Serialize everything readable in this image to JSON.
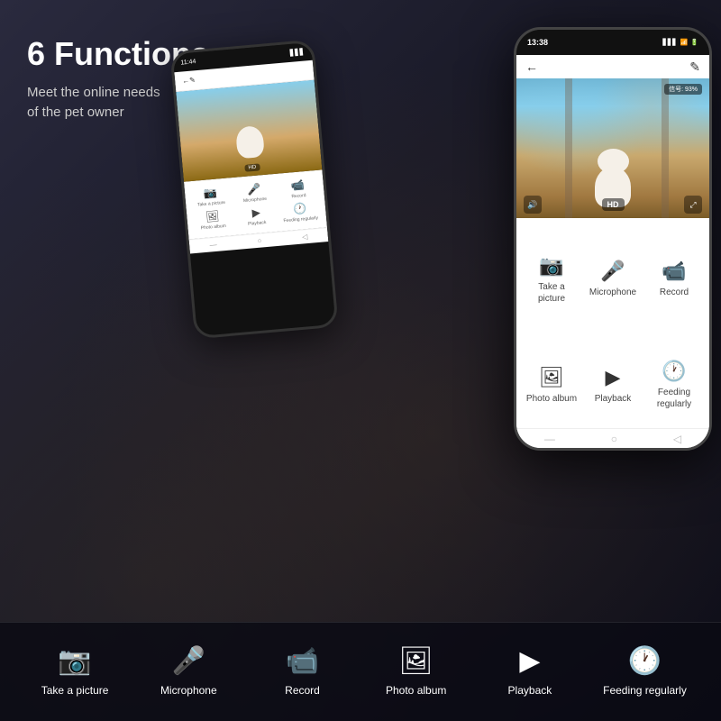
{
  "page": {
    "title": "6 Functions",
    "subtitle_line1": "Meet the online needs",
    "subtitle_line2": "of the pet owner"
  },
  "phone_large": {
    "status_time": "13:38",
    "signal_text": "信号: 93%",
    "back_icon": "←",
    "edit_icon": "✎",
    "hd_label": "HD",
    "video_signal": "信号: 93%",
    "buttons": [
      {
        "icon": "📷",
        "label": "Take a picture"
      },
      {
        "icon": "🎤",
        "label": "Microphone"
      },
      {
        "icon": "📹",
        "label": "Record"
      },
      {
        "icon": "🖼",
        "label": "Photo album"
      },
      {
        "icon": "▶",
        "label": "Playback"
      },
      {
        "icon": "🕐",
        "label": "Feeding regularly"
      }
    ],
    "navbar": [
      "—",
      "○",
      "◁"
    ]
  },
  "phone_small": {
    "buttons_row1": [
      {
        "icon": "📷",
        "label": "Take a picture"
      },
      {
        "icon": "🎤",
        "label": "Microphone"
      },
      {
        "icon": "📹",
        "label": "Record"
      }
    ],
    "buttons_row2": [
      {
        "icon": "🖼",
        "label": "Photo album"
      },
      {
        "icon": "▶",
        "label": "Playback"
      },
      {
        "icon": "🕐",
        "label": "Feeding regularly"
      }
    ]
  },
  "bottom_bar": {
    "items": [
      {
        "icon": "📷",
        "label": "Take a picture"
      },
      {
        "icon": "🎤",
        "label": "Microphone"
      },
      {
        "icon": "📹",
        "label": "Record"
      },
      {
        "icon": "🖼",
        "label": "Photo album"
      },
      {
        "icon": "▶",
        "label": "Playback"
      },
      {
        "icon": "🕐",
        "label": "Feeding regularly"
      }
    ]
  }
}
